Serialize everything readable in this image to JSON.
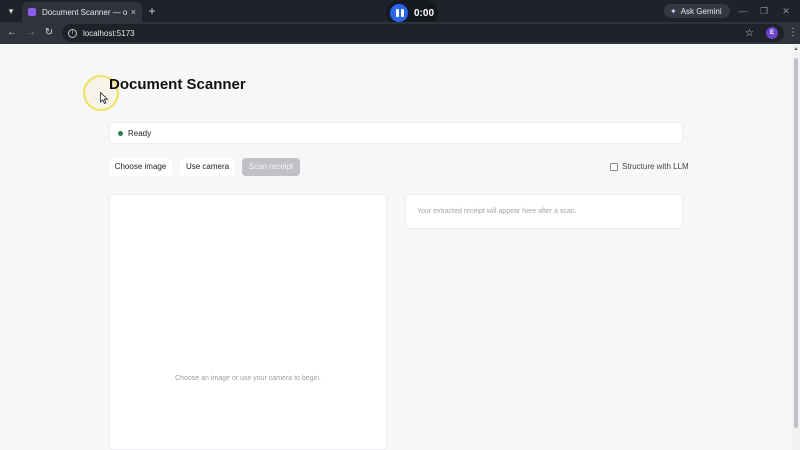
{
  "browser": {
    "tab": {
      "title": "Document Scanner — on-devic",
      "close_glyph": "×"
    },
    "new_tab_glyph": "+",
    "tab_menu_glyph": "▾",
    "recorder": {
      "time": "0:00"
    },
    "ask_gemini": {
      "label": "Ask Gemini",
      "icon": "sparkle-icon"
    },
    "window_controls": {
      "minimize": "—",
      "restore": "❐",
      "close": "✕"
    },
    "nav": {
      "back": "←",
      "forward": "→",
      "reload": "↻"
    },
    "address": {
      "url": "localhost:5173"
    },
    "star_glyph": "☆",
    "profile_initial": "E",
    "menu_glyph": "⋮"
  },
  "page": {
    "title": "Document Scanner",
    "status": {
      "text": "Ready",
      "dot_color": "#2f7d4f"
    },
    "buttons": {
      "choose_image": "Choose image",
      "use_camera": "Use camera",
      "scan_receipt": "Scan receipt"
    },
    "llm_toggle": {
      "label": "Structure with LLM",
      "checked": false
    },
    "image_panel": {
      "placeholder": "Choose an image or use your camera to begin."
    },
    "result_panel": {
      "placeholder": "Your extracted receipt will appear here after a scan."
    }
  }
}
